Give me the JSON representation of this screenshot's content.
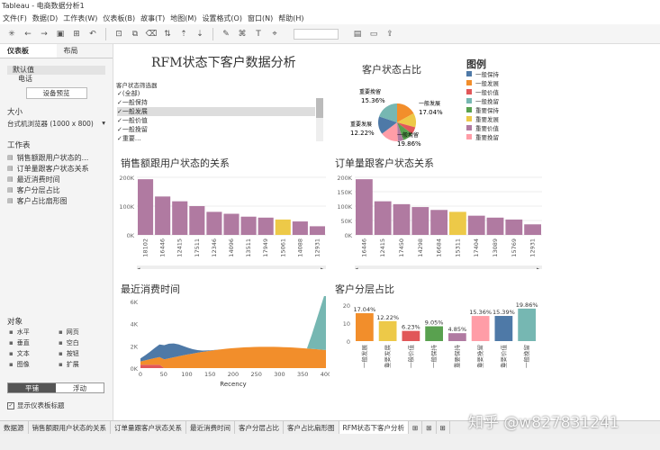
{
  "window": {
    "title": "Tableau - 电商数据分析1"
  },
  "menu": [
    "文件(F)",
    "数据(D)",
    "工作表(W)",
    "仪表板(B)",
    "故事(T)",
    "地图(M)",
    "设置格式(O)",
    "窗口(N)",
    "帮助(H)"
  ],
  "sidebar": {
    "tabs": [
      "仪表板",
      "布局"
    ],
    "device_items": [
      "默认值",
      "电话"
    ],
    "device_button": "设备预览",
    "size_label": "大小",
    "size_value": "台式机浏览器 (1000 x 800)",
    "worksheets_label": "工作表",
    "worksheets": [
      "销售额跟用户状态的...",
      "订单量跟客户状态关系",
      "最近消费时间",
      "客户分层占比",
      "客户占比扇形图"
    ],
    "objects_label": "对象",
    "objects": [
      [
        "水平",
        "网页"
      ],
      [
        "垂直",
        "空白"
      ],
      [
        "文本",
        "按钮"
      ],
      [
        "图像",
        "扩展"
      ]
    ],
    "tile_toggle": [
      "平铺",
      "浮动"
    ],
    "show_title": "显示仪表板标题"
  },
  "dashboard": {
    "title": "RFM状态下客户数据分析",
    "filter": {
      "title": "客户状态筛选器",
      "options": [
        "(全部)",
        "一般保持",
        "一般发展",
        "一般价值",
        "一般挽留",
        "重要..."
      ]
    },
    "pie": {
      "title": "客户状态占比",
      "labels": [
        "重要挽留",
        "15.36%",
        "一般发展",
        "17.04%",
        "重要发展",
        "12.22%",
        "一般挽留",
        "19.86%"
      ]
    },
    "legend": {
      "title": "图例",
      "items": [
        "一般保持",
        "一般发展",
        "一般价值",
        "一般挽留",
        "重要保持",
        "重要发展",
        "重要价值",
        "重要挽留"
      ],
      "colors": [
        "#4e79a7",
        "#f28e2b",
        "#e15759",
        "#76b7b2",
        "#59a14f",
        "#edc948",
        "#b07aa1",
        "#ff9da7"
      ]
    },
    "charts_titles": [
      "销售额跟用户状态的关系",
      "订单量跟客户状态关系",
      "最近消费时间",
      "客户分层占比"
    ],
    "recency_xlabel": "Recency"
  },
  "chart_data": [
    {
      "type": "bar",
      "title": "销售额跟用户状态的关系",
      "categories": [
        "18102",
        "16446",
        "12415",
        "17511",
        "12346",
        "14096",
        "13511",
        "17949",
        "15061",
        "14088",
        "12931"
      ],
      "values": [
        290,
        200,
        175,
        150,
        120,
        110,
        95,
        90,
        80,
        70,
        45
      ],
      "yticks": [
        "200K",
        "100K",
        "0K"
      ],
      "ylim": [
        0,
        300
      ],
      "highlight_index": 8
    },
    {
      "type": "bar",
      "title": "订单量跟客户状态关系",
      "categories": [
        "16446",
        "12415",
        "17450",
        "14298",
        "16684",
        "15311",
        "17404",
        "13089",
        "15769",
        "12931"
      ],
      "values": [
        290,
        175,
        160,
        145,
        130,
        120,
        100,
        90,
        80,
        55
      ],
      "yticks": [
        "200K",
        "150K",
        "100K",
        "50K",
        "0K"
      ],
      "ylim": [
        0,
        300
      ],
      "highlight_index": 5
    },
    {
      "type": "area",
      "title": "最近消费时间",
      "x": [
        0,
        50,
        100,
        150,
        200,
        250,
        300,
        350,
        400
      ],
      "xlabel": "Recency",
      "yticks": [
        "6K",
        "4K",
        "2K",
        "0K"
      ]
    },
    {
      "type": "bar",
      "title": "客户分层占比",
      "categories": [
        "一般发展",
        "重要发展",
        "一般价值",
        "一般保持",
        "重要保持",
        "重要挽留",
        "重要价值",
        "一般挽留"
      ],
      "values": [
        17.04,
        12.22,
        6.23,
        9.05,
        4.85,
        15.36,
        15.39,
        19.86
      ],
      "labels": [
        "17.04%",
        "12.22%",
        "6.23%",
        "9.05%",
        "4.85%",
        "15.36%",
        "15.39%",
        "19.86%"
      ],
      "colors": [
        "#f28e2b",
        "#edc948",
        "#e15759",
        "#59a14f",
        "#b07aa1",
        "#ff9da7",
        "#4e79a7",
        "#76b7b2"
      ],
      "yticks": [
        "20",
        "10",
        "0"
      ]
    }
  ],
  "tabs": [
    "数据源",
    "销售额跟用户状态的关系",
    "订单量跟客户状态关系",
    "最近消费时间",
    "客户分层占比",
    "客户占比扇形图",
    "RFM状态下客户分析"
  ],
  "watermark": "知乎 @w827831241"
}
